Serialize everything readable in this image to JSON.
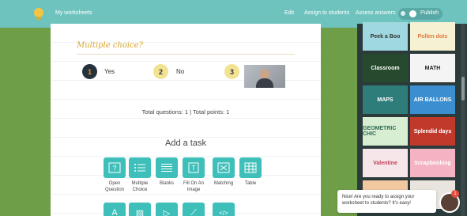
{
  "topbar": {
    "title": "My worksheets",
    "edit": "Edit",
    "assign": "Assign to students",
    "assess": "Assess answers",
    "publish": "Publish"
  },
  "question": {
    "title": "Multiple choice?",
    "options": [
      {
        "num": "1",
        "label": "Yes"
      },
      {
        "num": "2",
        "label": "No"
      },
      {
        "num": "3",
        "label": ""
      }
    ]
  },
  "totals": "Total questions: 1 | Total points: 1",
  "add_task": {
    "heading": "Add a task",
    "items": [
      {
        "label": "Open Question",
        "icon": "question-mark-icon"
      },
      {
        "label": "Multiple Choice",
        "icon": "list-icon"
      },
      {
        "label": "Blanks",
        "icon": "lines-icon"
      },
      {
        "label": "Fill On An Image",
        "icon": "image-text-icon"
      },
      {
        "label": "Matching",
        "icon": "matching-icon"
      },
      {
        "label": "Table",
        "icon": "table-icon"
      }
    ],
    "row2_icons": [
      "text-icon",
      "image-icon",
      "video-icon",
      "link-icon",
      "code-icon"
    ],
    "row2_glyphs": [
      "A",
      "▨",
      "▷",
      "⟋",
      "</>"
    ]
  },
  "themes": [
    {
      "label": "Peek a Boo",
      "bg": "#9fd8e0",
      "color": "#333"
    },
    {
      "label": "Pollen dots",
      "bg": "#f7f1d4",
      "color": "#e07a3a"
    },
    {
      "label": "Classroom",
      "bg": "#274a2e",
      "color": "#ffffff"
    },
    {
      "label": "MATH",
      "bg": "#f4f4f4",
      "color": "#222"
    },
    {
      "label": "MAPS",
      "bg": "#2f7d7a",
      "color": "#ffffff"
    },
    {
      "label": "AIR BALLONS",
      "bg": "#3b8fd0",
      "color": "#ffffff"
    },
    {
      "label": "GEOMETRIC CHIC",
      "bg": "#d8eed3",
      "color": "#2e6b52"
    },
    {
      "label": "Splendid days",
      "bg": "#c0392b",
      "color": "#ffffff"
    },
    {
      "label": "Valentine",
      "bg": "#f6e6ea",
      "color": "#c0455a"
    },
    {
      "label": "Scrapbooking",
      "bg": "#f3b3c2",
      "color": "#ffffff"
    },
    {
      "label": "",
      "bg": "#f2c8a0",
      "color": "#333"
    },
    {
      "label": "",
      "bg": "#e9e4de",
      "color": "#333"
    }
  ],
  "chat": {
    "message": "Nice! Are you ready to assign your worksheet to students? It's easy!",
    "badge": "1"
  },
  "colors": {
    "accent": "#6fc3bf",
    "task": "#3fbfba",
    "background": "#6e9e48"
  }
}
